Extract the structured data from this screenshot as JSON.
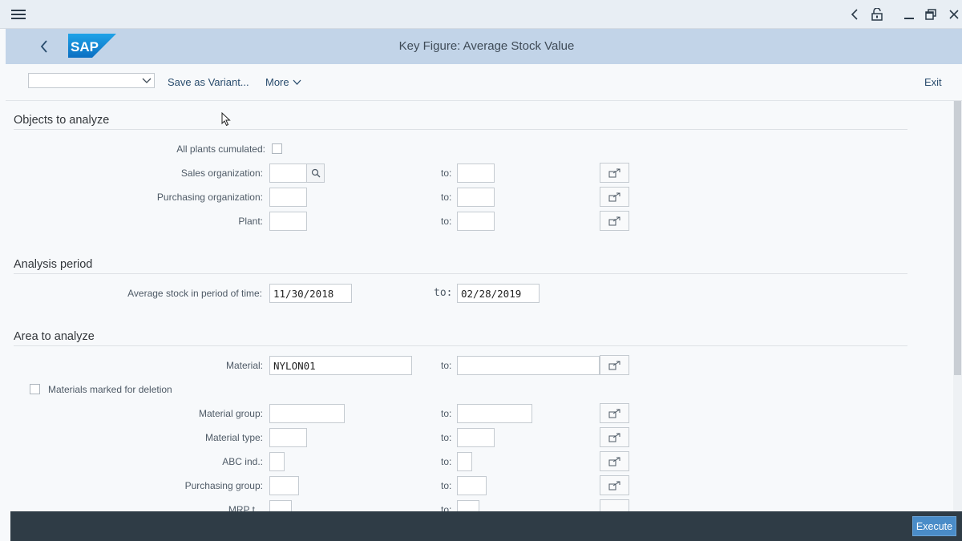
{
  "window": {
    "title": "Key Figure: Average Stock Value",
    "brand": "SAP"
  },
  "toolbar": {
    "variant_value": "",
    "save_variant": "Save as Variant...",
    "more": "More",
    "exit": "Exit"
  },
  "sections": {
    "objects": "Objects to analyze",
    "period": "Analysis period",
    "area": "Area to analyze"
  },
  "labels": {
    "all_plants": "All plants cumulated:",
    "sales_org": "Sales organization:",
    "purch_org": "Purchasing organization:",
    "plant": "Plant:",
    "avg_stock": "Average stock in period of time:",
    "material": "Material:",
    "marked_deletion": "Materials marked for deletion",
    "material_group": "Material group:",
    "material_type": "Material type:",
    "abc_ind": "ABC ind.:",
    "purch_group": "Purchasing group:",
    "mrp_type": "MRP t...",
    "to": "to:"
  },
  "values": {
    "period_from": "11/30/2018",
    "period_to": "02/28/2019",
    "material_from": "NYLON01",
    "material_to": "",
    "sales_org_from": "",
    "sales_org_to": "",
    "purch_org_from": "",
    "purch_org_to": "",
    "plant_from": "",
    "plant_to": "",
    "material_group_from": "",
    "material_group_to": "",
    "material_type_from": "",
    "material_type_to": "",
    "abc_from": "",
    "abc_to": "",
    "purch_group_from": "",
    "purch_group_to": ""
  },
  "footer": {
    "execute": "Execute"
  },
  "colors": {
    "shellbar": "#c2d4e8",
    "footer": "#2f3c46",
    "execute": "#4a8cc8",
    "link": "#2a4d6e"
  }
}
